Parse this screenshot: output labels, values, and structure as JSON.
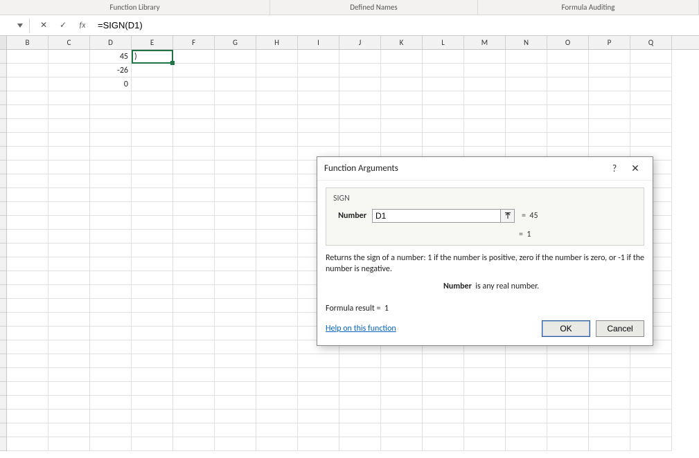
{
  "ribbon": {
    "groups": [
      "Function Library",
      "Defined Names",
      "Formula Auditing"
    ]
  },
  "formula_bar": {
    "name_box": "",
    "cancel_glyph": "✕",
    "enter_glyph": "✓",
    "fx_label": "fx",
    "formula": "=SIGN(D1)"
  },
  "grid": {
    "columns": [
      "B",
      "C",
      "D",
      "E",
      "F",
      "G",
      "H",
      "I",
      "J",
      "K",
      "L",
      "M",
      "N",
      "O",
      "P",
      "Q"
    ],
    "data": {
      "D1": "45",
      "D2": "-26",
      "D3": "0"
    },
    "active_cell": {
      "ref": "E1",
      "display": ")"
    }
  },
  "dialog": {
    "title": "Function Arguments",
    "help_glyph": "?",
    "close_glyph": "✕",
    "function_name": "SIGN",
    "argument_label": "Number",
    "argument_value": "D1",
    "collapse_glyph": "↥",
    "arg_eval_prefix": "=",
    "arg_eval_value": "45",
    "result_prefix": "=",
    "result_value": "1",
    "description": "Returns the sign of a number: 1 if the number is positive, zero if the number is zero, or -1 if the number is negative.",
    "arg_desc_name": "Number",
    "arg_desc_text": "is any real number.",
    "formula_result_label": "Formula result =",
    "formula_result_value": "1",
    "help_link": "Help on this function",
    "ok_label": "OK",
    "cancel_label": "Cancel"
  }
}
